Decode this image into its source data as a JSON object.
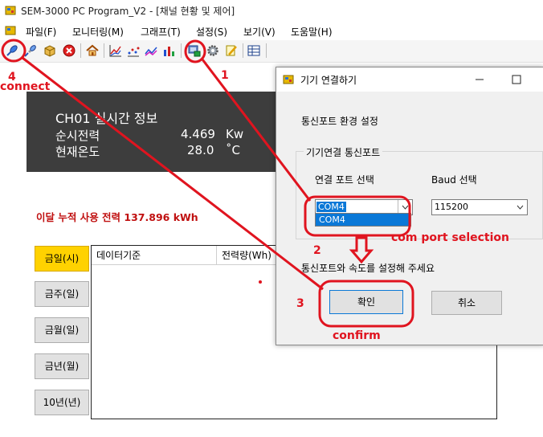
{
  "window": {
    "title": "SEM-3000 PC Program_V2 - [채널 현황 및 제어]"
  },
  "menu": [
    {
      "label": "파일(F)"
    },
    {
      "label": "모니터링(M)"
    },
    {
      "label": "그래프(T)"
    },
    {
      "label": "설정(S)"
    },
    {
      "label": "보기(V)"
    },
    {
      "label": "도움말(H)"
    }
  ],
  "toolbar": {
    "icons": [
      "connect-icon",
      "disconnect-icon",
      "box-icon",
      "stop-icon",
      "home-icon",
      "chart-icon",
      "scatter-icon",
      "line-chart-icon",
      "bar-chart-icon",
      "device-connect-icon",
      "gear-icon",
      "edit-icon",
      "table-icon"
    ]
  },
  "info": {
    "title": "CH01  실시간 정보",
    "power_label": "순시전력",
    "power_value": "4.469",
    "power_unit": "Kw",
    "temp_label": "현재온도",
    "temp_value": "28.0",
    "temp_unit": "˚C"
  },
  "monthly": {
    "text": "이달 누적 사용 전력  137.896 kWh"
  },
  "period_buttons": [
    {
      "label": "금일(시)"
    },
    {
      "label": "금주(일)"
    },
    {
      "label": "금월(일)"
    },
    {
      "label": "금년(월)"
    },
    {
      "label": "10년(년)"
    }
  ],
  "table": {
    "columns": [
      "데이터기준",
      "전력량(Wh)"
    ]
  },
  "dialog": {
    "title": "기기 연결하기",
    "section_label": "통신포트 환경 설정",
    "group_label": "기기연결 통신포트",
    "port_label": "연결 포트 선택",
    "baud_label": "Baud 선택",
    "port_value": "COM4",
    "port_option": "COM4",
    "baud_value": "115200",
    "message": "통신포트와 속도를 설정해 주세요",
    "confirm_label": "확인",
    "cancel_label": "취소"
  },
  "annotations": {
    "label_1": "1",
    "label_2": "2",
    "label_3": "3",
    "label_4": "4",
    "connect_label": "connect",
    "port_selection_label": "com port selection",
    "confirm_caption": "confirm",
    "color": "#e0141f"
  },
  "colors": {
    "info_panel": "#3d3d3d",
    "active_button": "#ffd200",
    "monthly_text": "#c01010",
    "selection": "#0a78d7"
  }
}
